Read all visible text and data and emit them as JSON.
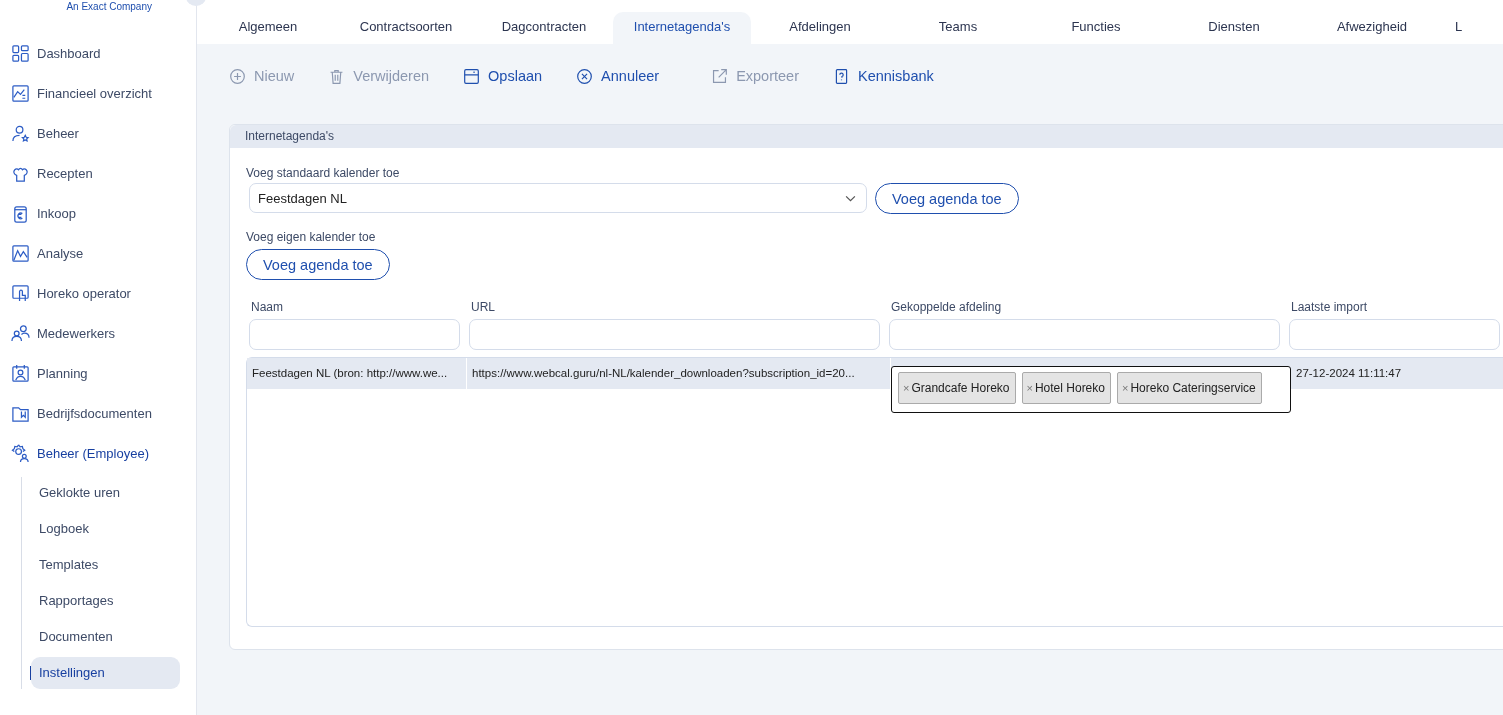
{
  "sidebar": {
    "tagline": "An Exact Company",
    "items": [
      {
        "label": "Dashboard",
        "selected": false
      },
      {
        "label": "Financieel overzicht",
        "selected": false
      },
      {
        "label": "Beheer",
        "selected": false
      },
      {
        "label": "Recepten",
        "selected": false
      },
      {
        "label": "Inkoop",
        "selected": false
      },
      {
        "label": "Analyse",
        "selected": false
      },
      {
        "label": "Horeko operator",
        "selected": false
      },
      {
        "label": "Medewerkers",
        "selected": false
      },
      {
        "label": "Planning",
        "selected": false
      },
      {
        "label": "Bedrijfsdocumenten",
        "selected": false
      },
      {
        "label": "Beheer (Employee)",
        "selected": true,
        "children": [
          {
            "label": "Geklokte uren",
            "selected": false
          },
          {
            "label": "Logboek",
            "selected": false
          },
          {
            "label": "Templates",
            "selected": false
          },
          {
            "label": "Rapportages",
            "selected": false
          },
          {
            "label": "Documenten",
            "selected": false
          },
          {
            "label": "Instellingen",
            "selected": true
          }
        ]
      }
    ]
  },
  "tabs": [
    {
      "label": "Algemeen",
      "selected": false
    },
    {
      "label": "Contractsoorten",
      "selected": false
    },
    {
      "label": "Dagcontracten",
      "selected": false
    },
    {
      "label": "Internetagenda's",
      "selected": true
    },
    {
      "label": "Afdelingen",
      "selected": false
    },
    {
      "label": "Teams",
      "selected": false
    },
    {
      "label": "Functies",
      "selected": false
    },
    {
      "label": "Diensten",
      "selected": false
    },
    {
      "label": "Afwezigheid",
      "selected": false
    },
    {
      "label": "L",
      "selected": false
    }
  ],
  "toolbar": [
    {
      "label": "Nieuw",
      "disabled": true
    },
    {
      "label": "Verwijderen",
      "disabled": true
    },
    {
      "label": "Opslaan",
      "disabled": false
    },
    {
      "label": "Annuleer",
      "disabled": false
    },
    {
      "label": "Exporteer",
      "disabled": true
    },
    {
      "label": "Kennisbank",
      "disabled": false
    }
  ],
  "panel": {
    "title": "Internetagenda's",
    "standard": {
      "label": "Voeg standaard kalender toe",
      "value": "Feestdagen NL",
      "button": "Voeg agenda toe"
    },
    "own": {
      "label": "Voeg eigen kalender toe",
      "button": "Voeg agenda toe"
    },
    "columns": [
      "Naam",
      "URL",
      "Gekoppelde afdeling",
      "Laatste import"
    ],
    "rows": [
      {
        "selected": true,
        "name": "Feestdagen NL (bron: http://www.we...",
        "url": "https://www.webcal.guru/nl-NL/kalender_downloaden?subscription_id=20...",
        "departments": [
          {
            "remove": "×",
            "label": "Grandcafe Horeko"
          },
          {
            "remove": "×",
            "label": "Hotel Horeko"
          },
          {
            "remove": "×",
            "label": "Horeko Cateringservice"
          }
        ],
        "last_import": "27-12-2024 11:11:47"
      }
    ]
  }
}
